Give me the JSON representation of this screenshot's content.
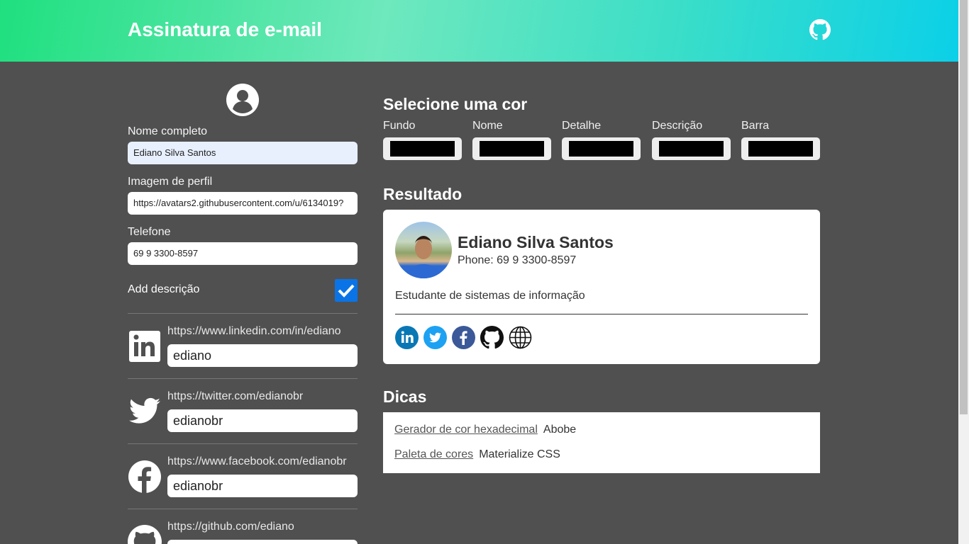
{
  "header": {
    "title": "Assinatura de e-mail",
    "github_icon": "github-icon"
  },
  "form": {
    "avatar_icon": "user-circle-icon",
    "name_label": "Nome completo",
    "name_value": "Ediano Silva Santos",
    "image_label": "Imagem de perfil",
    "image_value": "https://avatars2.githubusercontent.com/u/6134019?",
    "phone_label": "Telefone",
    "phone_value": "69 9 3300-8597",
    "description_label": "Add descrição",
    "description_checked": true
  },
  "social": [
    {
      "name": "linkedin",
      "icon": "linkedin-icon",
      "url": "https://www.linkedin.com/in/ediano",
      "value": "ediano"
    },
    {
      "name": "twitter",
      "icon": "twitter-icon",
      "url": "https://twitter.com/edianobr",
      "value": "edianobr"
    },
    {
      "name": "facebook",
      "icon": "facebook-icon",
      "url": "https://www.facebook.com/edianobr",
      "value": "edianobr"
    },
    {
      "name": "github",
      "icon": "github-icon",
      "url": "https://github.com/ediano",
      "value": ""
    }
  ],
  "colors": {
    "title": "Selecione uma cor",
    "items": [
      {
        "label": "Fundo",
        "value": "#000000"
      },
      {
        "label": "Nome",
        "value": "#000000"
      },
      {
        "label": "Detalhe",
        "value": "#000000"
      },
      {
        "label": "Descrição",
        "value": "#000000"
      },
      {
        "label": "Barra",
        "value": "#000000"
      }
    ]
  },
  "result": {
    "title": "Resultado",
    "name": "Ediano Silva Santos",
    "phone": "Phone: 69 9 3300-8597",
    "description": "Estudante de sistemas de informação",
    "icons": [
      "linkedin-icon",
      "twitter-icon",
      "facebook-icon",
      "github-icon",
      "globe-icon"
    ]
  },
  "tips": {
    "title": "Dicas",
    "rows": [
      {
        "link": "Gerador de cor hexadecimal",
        "text": "Abobe"
      },
      {
        "link": "Paleta de cores",
        "text": "Materialize CSS"
      }
    ]
  }
}
